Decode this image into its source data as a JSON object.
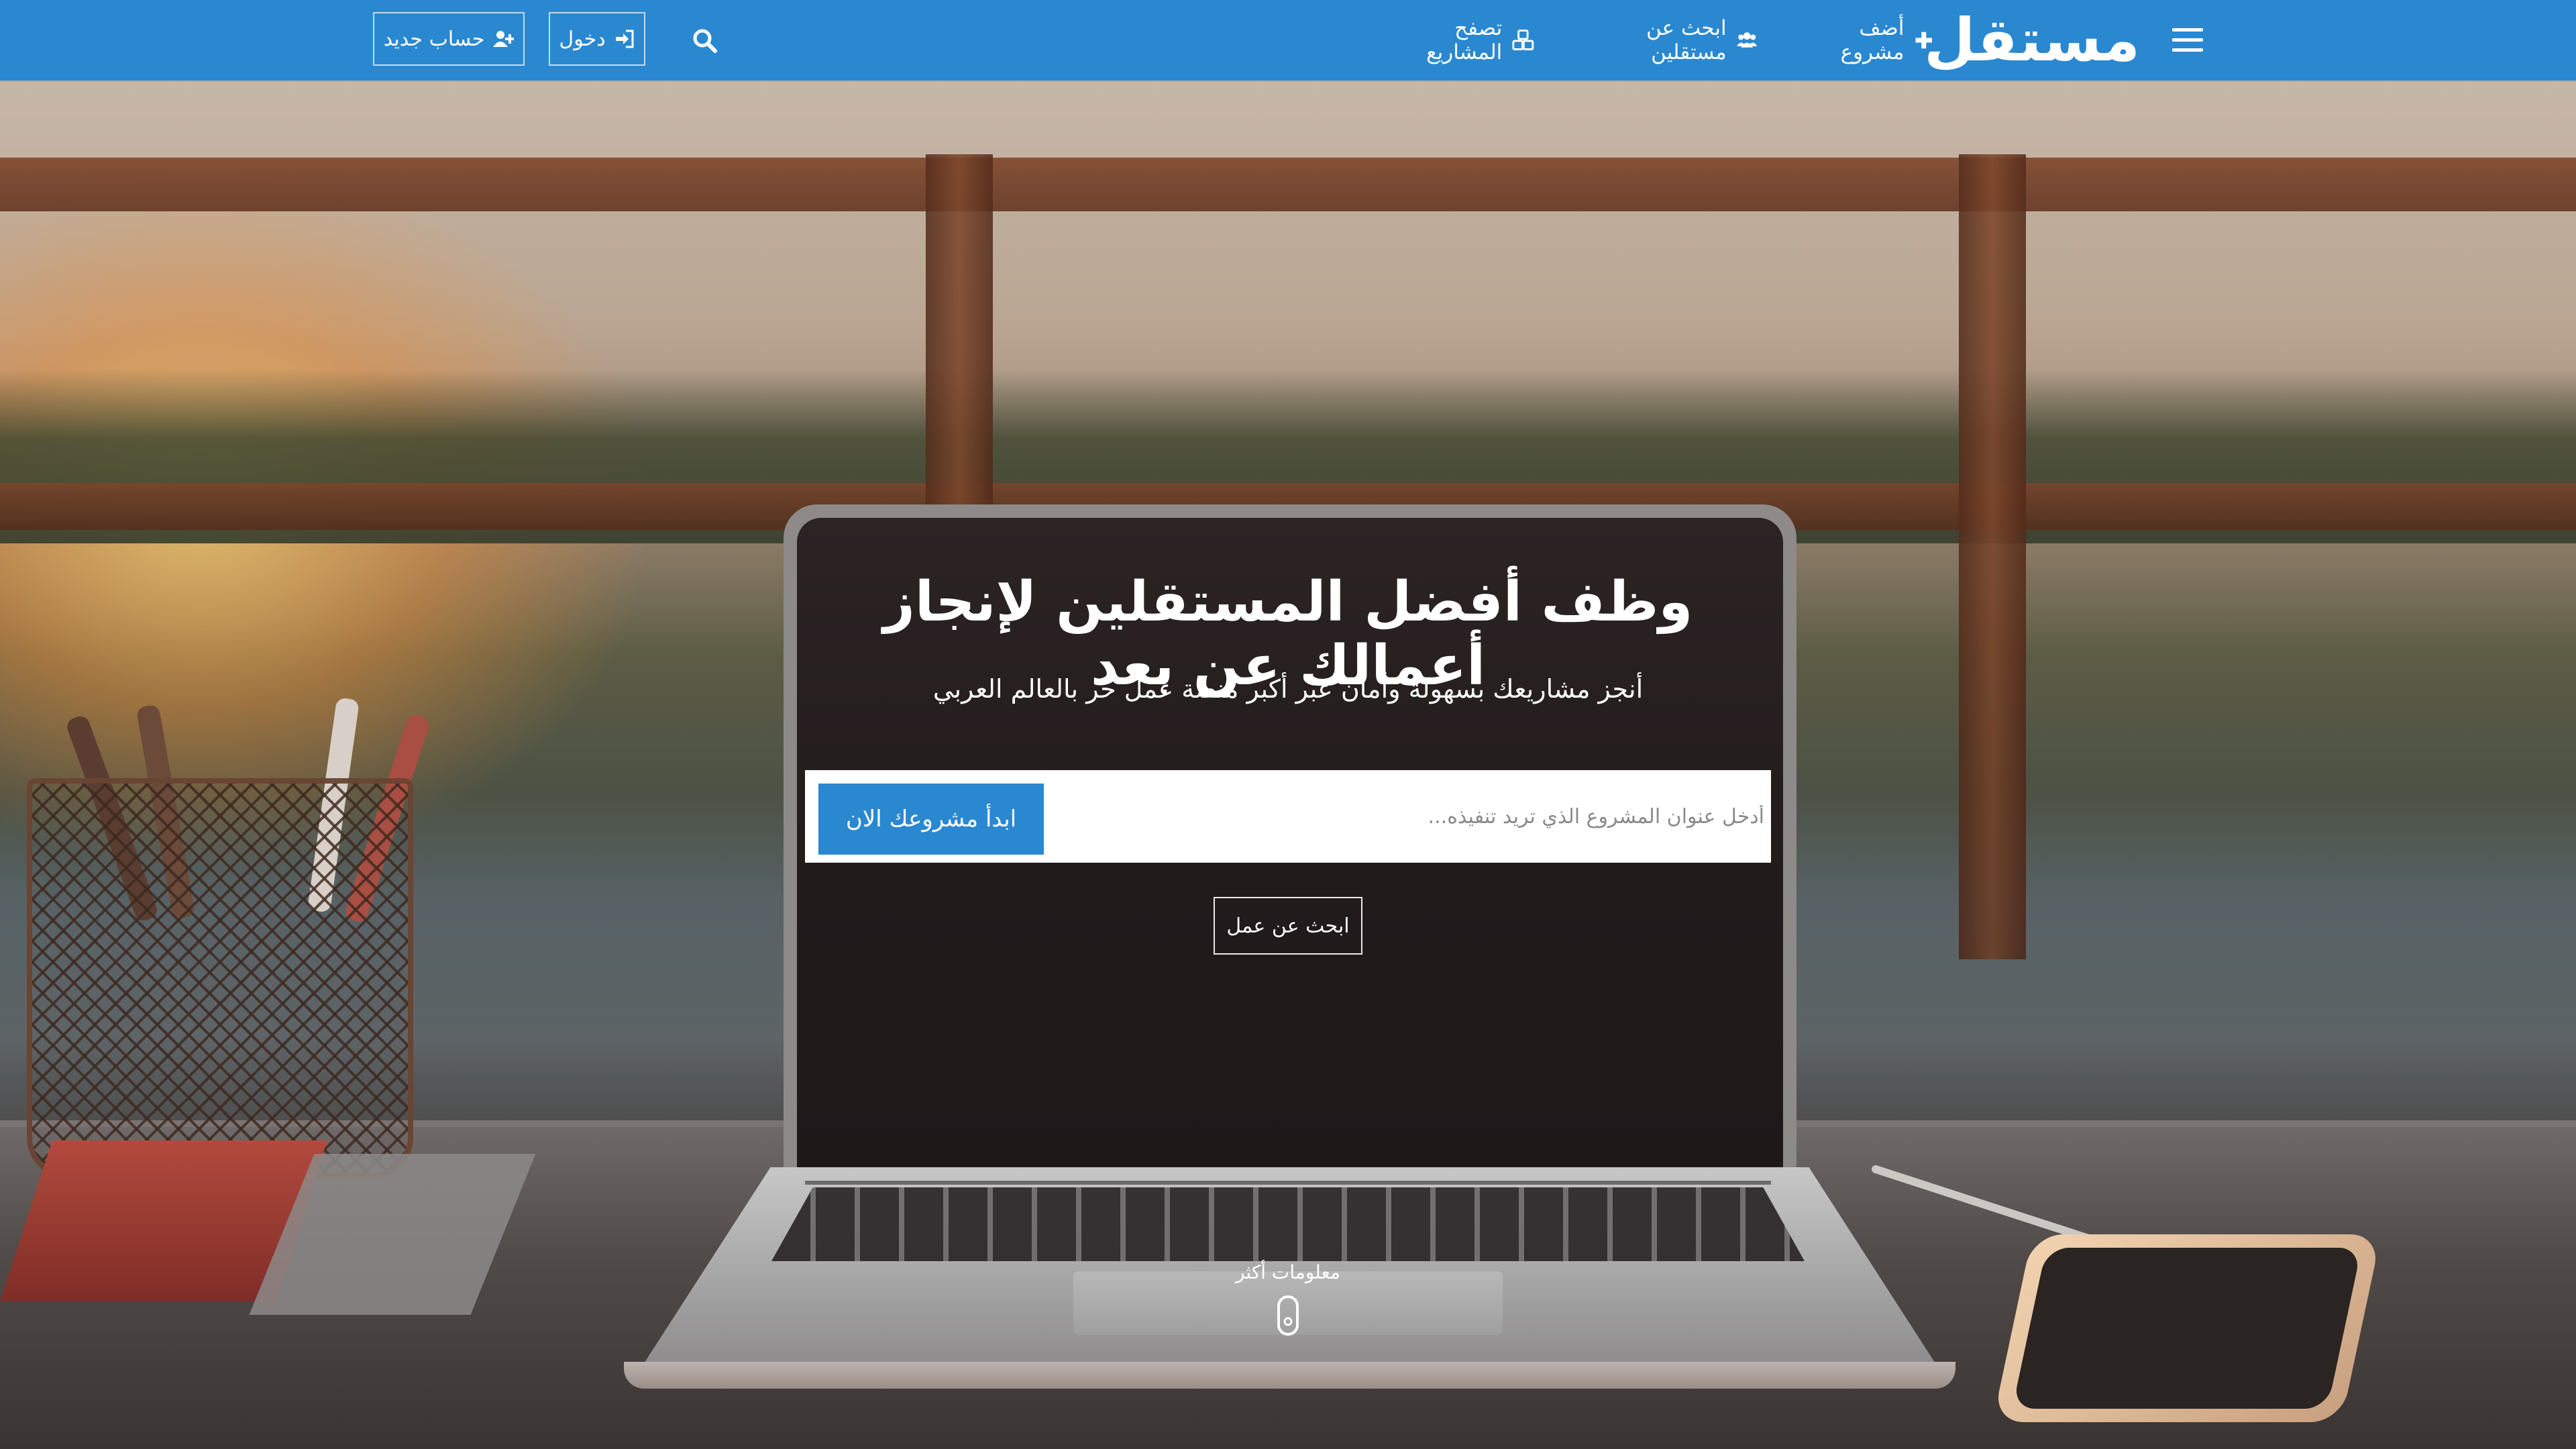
{
  "header": {
    "logo_text": "مستقل",
    "nav": {
      "add_project": "أضف مشروع",
      "find_freelancers": "ابحث عن مستقلين",
      "browse_projects": "تصفح المشاريع"
    },
    "login_label": "دخول",
    "signup_label": "حساب جديد",
    "icons": {
      "menu": "hamburger-menu-icon",
      "add": "plus-icon",
      "users": "users-icon",
      "cubes": "cubes-icon",
      "login": "sign-in-icon",
      "signup": "user-plus-icon",
      "search": "search-icon"
    }
  },
  "hero": {
    "headline": "وظف أفضل المستقلين لإنجاز أعمالك عن بعد",
    "subheadline": "أنجز مشاريعك بسهولة وأمان عبر أكبر منصة عمل حر بالعالم العربي",
    "project_input": {
      "placeholder": "أدخل عنوان المشروع الذي تريد تنفيذه...",
      "value": ""
    },
    "start_button": "ابدأ مشروعك الان",
    "find_job_button": "ابحث عن عمل",
    "more_info_label": "معلومات أكثر",
    "more_info_icon": "mouse-scroll-icon"
  },
  "colors": {
    "brand_blue": "#2a88d1",
    "white": "#ffffff"
  }
}
